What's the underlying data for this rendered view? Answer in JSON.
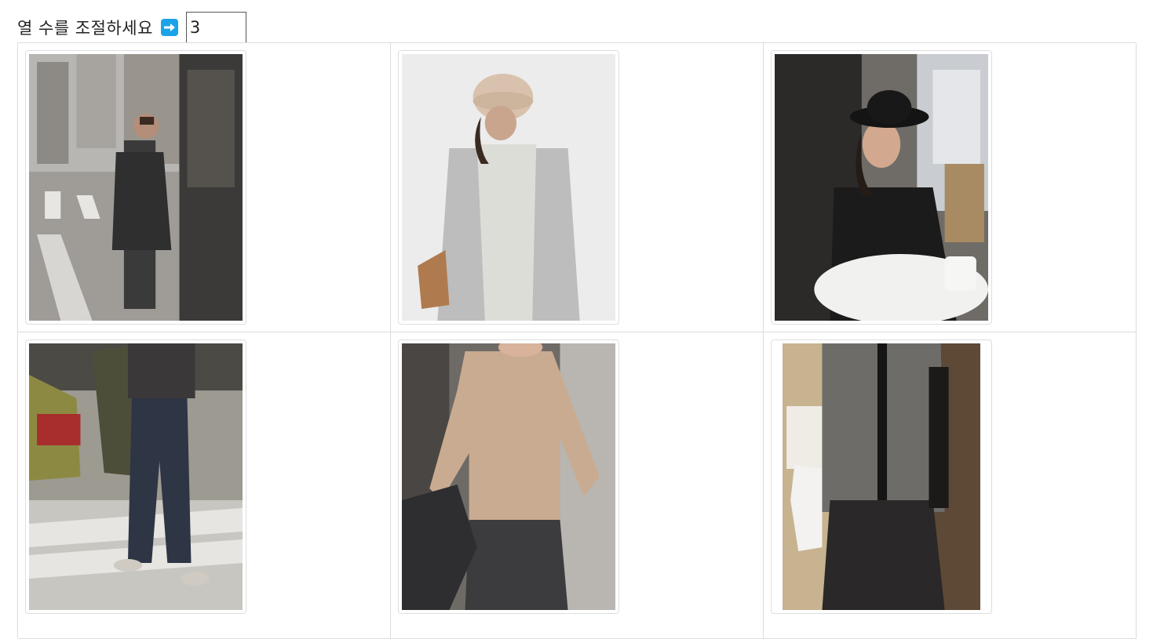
{
  "control": {
    "label": "열 수를 조절하세요",
    "icon": "right-arrow-icon",
    "columns_value": "3",
    "accent_color": "#1aa3e8"
  },
  "grid": {
    "columns": 3,
    "items": [
      {
        "name": "photo-street-dark-scarf",
        "alt": ""
      },
      {
        "name": "photo-knit-hat-grey-coat",
        "alt": ""
      },
      {
        "name": "photo-black-hat-cafe",
        "alt": ""
      },
      {
        "name": "photo-parking-jeans",
        "alt": ""
      },
      {
        "name": "photo-beige-knit-top",
        "alt": ""
      },
      {
        "name": "photo-grey-vest-cafe",
        "alt": ""
      }
    ]
  }
}
